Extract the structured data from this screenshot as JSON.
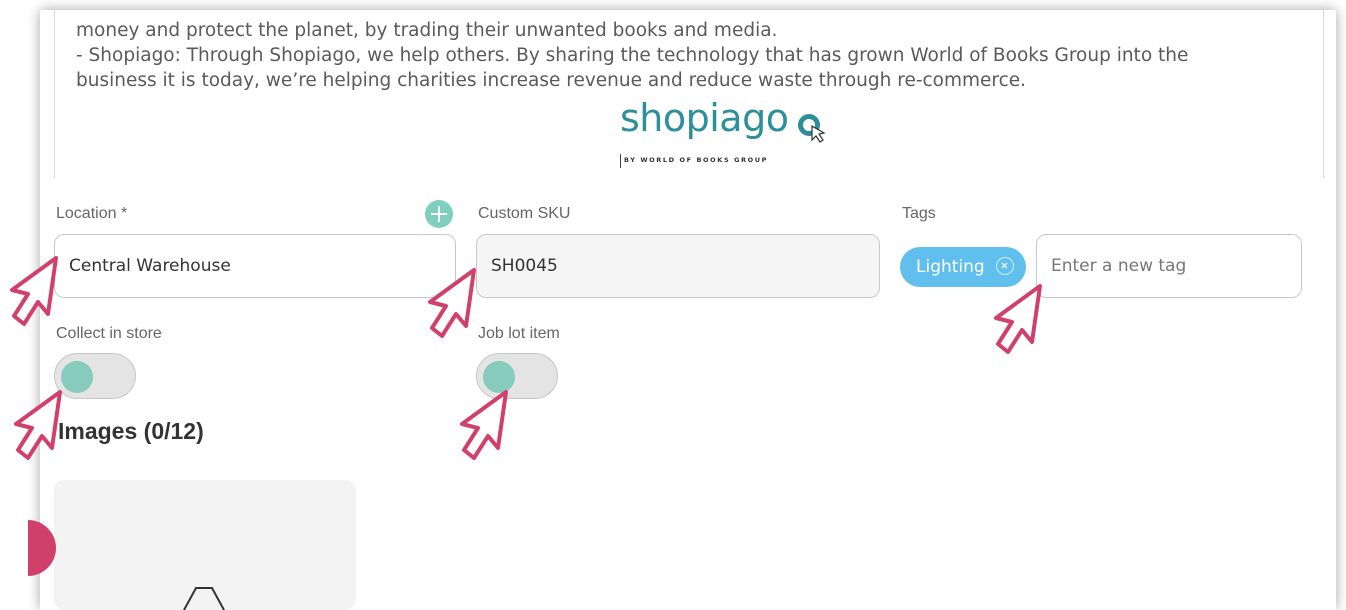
{
  "description": {
    "line1": "money and protect the planet, by trading their unwanted books and media.",
    "line2": "- Shopiago: Through Shopiago, we help others. By sharing the technology that has grown World of Books Group into the",
    "line3": "business it is today, we’re helping charities increase revenue and reduce waste through re-commerce."
  },
  "logo": {
    "word": "shopiago",
    "subtitle": "BY WORLD OF BOOKS GROUP"
  },
  "form": {
    "location": {
      "label": "Location *",
      "value": "Central Warehouse"
    },
    "custom_sku": {
      "label": "Custom SKU",
      "value": "SH0045"
    },
    "tags": {
      "label": "Tags",
      "chips": [
        "Lighting"
      ],
      "placeholder": "Enter a new tag"
    },
    "collect_in_store": {
      "label": "Collect in store",
      "on": false
    },
    "job_lot_item": {
      "label": "Job lot item",
      "on": false
    }
  },
  "images": {
    "heading": "Images (0/12)"
  },
  "colors": {
    "accent": "#86cbbd",
    "chip": "#61bfee",
    "cursor": "#d1406b",
    "logo": "#2d8f98"
  },
  "icons": [
    "plus-icon",
    "close-circle-icon",
    "pointer-cursor-icon",
    "upload-icon"
  ]
}
